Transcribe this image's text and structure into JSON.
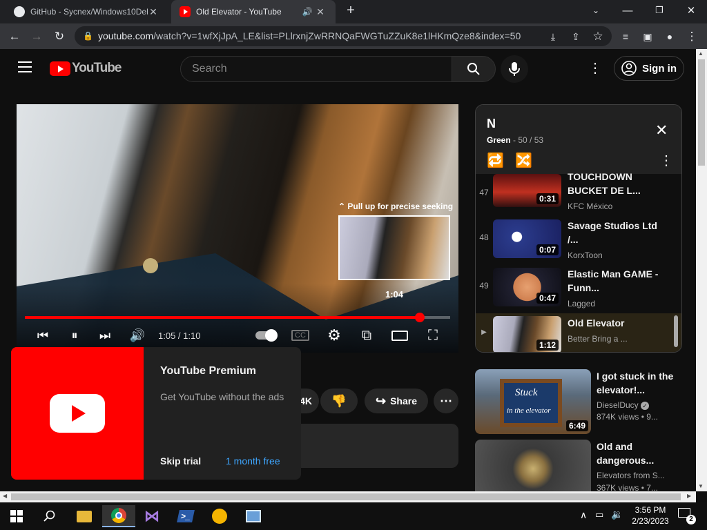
{
  "browser": {
    "tabs": [
      {
        "title": "GitHub - Sycnex/Windows10Debl",
        "active": false
      },
      {
        "title": "Old Elevator - YouTube",
        "active": true
      }
    ],
    "url_host": "youtube.com",
    "url_path": "/watch?v=1wfXjJpA_LE&list=PLlrxnjZwRRNQaFWGTuZZuK8e1lHKmQze8&index=50"
  },
  "youtube": {
    "logo_text": "YouTube",
    "search_placeholder": "Search",
    "signin_label": "Sign in"
  },
  "player": {
    "time": "1:05 / 1:10",
    "progress": 0.929,
    "seek_hint": "Pull up for precise seeking",
    "preview_time": "1:04"
  },
  "premium": {
    "title": "YouTube Premium",
    "subtitle": "Get YouTube without the ads",
    "skip_label": "Skip trial",
    "free_label": "1 month free"
  },
  "actions": {
    "like_count": "4K",
    "share_label": "Share"
  },
  "playlist": {
    "title": "N",
    "owner": "Green",
    "position": "- 50 / 53",
    "items": [
      {
        "index": "47",
        "title": "TOUCHDOWN BUCKET DE L...",
        "channel": "KFC México",
        "duration": "0:31"
      },
      {
        "index": "48",
        "title": "Savage Studios Ltd /...",
        "channel": "KorxToon",
        "duration": "0:07"
      },
      {
        "index": "49",
        "title": "Elastic Man GAME - Funn...",
        "channel": "Lagged",
        "duration": "0:47"
      },
      {
        "index": "▶",
        "title": "Old Elevator",
        "channel": "Better Bring a ...",
        "duration": "1:12"
      }
    ]
  },
  "recommendations": [
    {
      "title": "I got stuck in the elevator!...",
      "channel": "DieselDucy",
      "meta": "874K views  • 9...",
      "duration": "6:49",
      "thumb_text1": "Stuck",
      "thumb_text2": "in the elevator"
    },
    {
      "title": "Old and dangerous...",
      "channel": "Elevators from S...",
      "meta": "367K views  • 7...",
      "duration": ""
    }
  ],
  "taskbar": {
    "time": "3:56 PM",
    "date": "2/23/2023",
    "notifications": "2"
  }
}
